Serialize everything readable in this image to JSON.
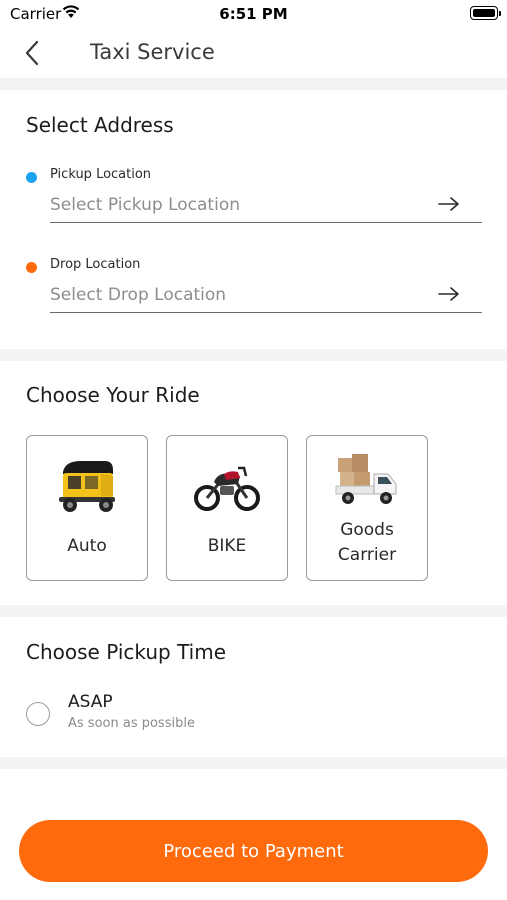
{
  "status_bar": {
    "carrier": "Carrier",
    "time": "6:51 PM"
  },
  "nav": {
    "title": "Taxi Service",
    "back_icon": "chevron-left-icon"
  },
  "address": {
    "title": "Select Address",
    "pickup": {
      "label": "Pickup Location",
      "placeholder": "Select Pickup Location",
      "dot_color": "#1da1f2"
    },
    "drop": {
      "label": "Drop Location",
      "placeholder": "Select Drop Location",
      "dot_color": "#ff6a0d"
    }
  },
  "ride": {
    "title": "Choose Your Ride",
    "options": [
      {
        "label": "Auto",
        "icon": "auto-rickshaw-icon"
      },
      {
        "label": "BIKE",
        "icon": "motorbike-icon"
      },
      {
        "label_line1": "Goods",
        "label_line2": "Carrier",
        "icon": "goods-truck-icon"
      }
    ]
  },
  "pickup_time": {
    "title": "Choose Pickup Time",
    "asap_title": "ASAP",
    "asap_subtitle": "As soon as possible"
  },
  "proceed_label": "Proceed to Payment",
  "colors": {
    "accent": "#ff6a0d",
    "pickup_dot": "#1da1f2",
    "band": "#f3f3f3"
  }
}
